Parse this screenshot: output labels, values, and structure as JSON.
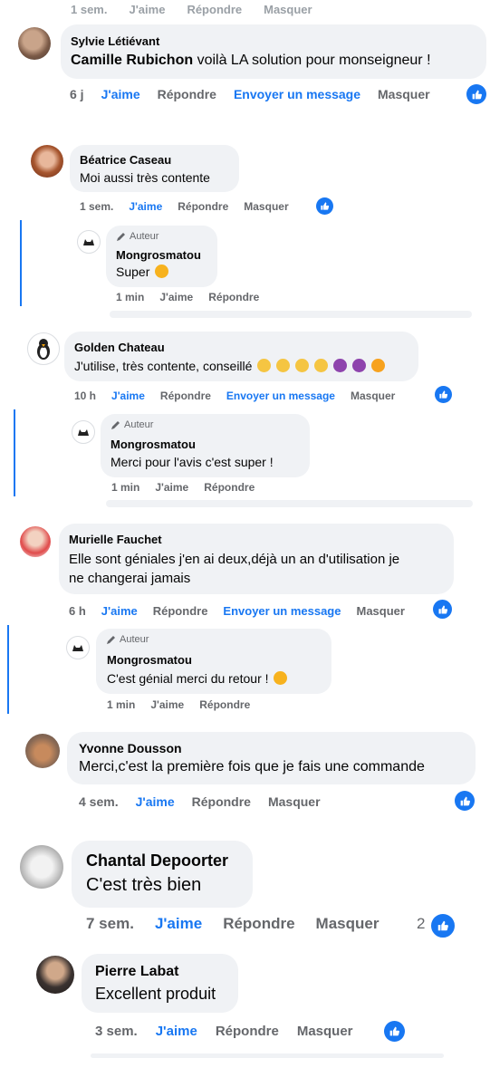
{
  "top_residual": {
    "time": "1 sem.",
    "like": "J'aime",
    "reply": "Répondre",
    "hide": "Masquer"
  },
  "comments": {
    "sylvie": {
      "name": "Sylvie Létiévant",
      "mention": "Camille Rubichon",
      "text": " voilà LA solution pour monseigneur !",
      "time": "6 j",
      "like": "J'aime",
      "reply": "Répondre",
      "send": "Envoyer un message",
      "hide": "Masquer"
    },
    "beatrice": {
      "name": "Béatrice Caseau",
      "text": "Moi aussi très contente",
      "time": "1 sem.",
      "like": "J'aime",
      "reply": "Répondre",
      "hide": "Masquer",
      "reply_comment": {
        "author_badge": "Auteur",
        "name": "Mongrosmatou",
        "text": "Super",
        "time": "1 min",
        "like": "J'aime",
        "reply": "Répondre"
      }
    },
    "golden": {
      "name": "Golden Chateau",
      "text": "J'utilise, très contente, conseillé",
      "time": "10 h",
      "like": "J'aime",
      "reply": "Répondre",
      "send": "Envoyer un message",
      "hide": "Masquer",
      "reply_comment": {
        "author_badge": "Auteur",
        "name": "Mongrosmatou",
        "text": "Merci pour l'avis c'est super !",
        "time": "1 min",
        "like": "J'aime",
        "reply": "Répondre"
      }
    },
    "murielle": {
      "name": "Murielle Fauchet",
      "text_line1": "Elle sont géniales j'en ai deux,déjà un an d'utilisation je",
      "text_line2": "ne changerai jamais",
      "time": "6 h",
      "like": "J'aime",
      "reply": "Répondre",
      "send": "Envoyer un message",
      "hide": "Masquer",
      "reply_comment": {
        "author_badge": "Auteur",
        "name": "Mongrosmatou",
        "text": "C'est génial merci du retour !",
        "time": "1 min",
        "like": "J'aime",
        "reply": "Répondre"
      }
    },
    "yvonne": {
      "name": "Yvonne Dousson",
      "text": "Merci,c'est la première fois que je fais une commande",
      "time": "4 sem.",
      "like": "J'aime",
      "reply": "Répondre",
      "hide": "Masquer"
    },
    "chantal": {
      "name": "Chantal Depoorter",
      "text": "C'est très bien",
      "time": "7 sem.",
      "like": "J'aime",
      "reply": "Répondre",
      "hide": "Masquer",
      "reaction_count": "2"
    },
    "pierre": {
      "name": "Pierre Labat",
      "text": "Excellent produit",
      "time": "3 sem.",
      "like": "J'aime",
      "reply": "Répondre",
      "hide": "Masquer"
    }
  },
  "colors": {
    "accent": "#1877f2",
    "bubble": "#f0f2f5",
    "muted": "#65676b",
    "text": "#050505"
  }
}
